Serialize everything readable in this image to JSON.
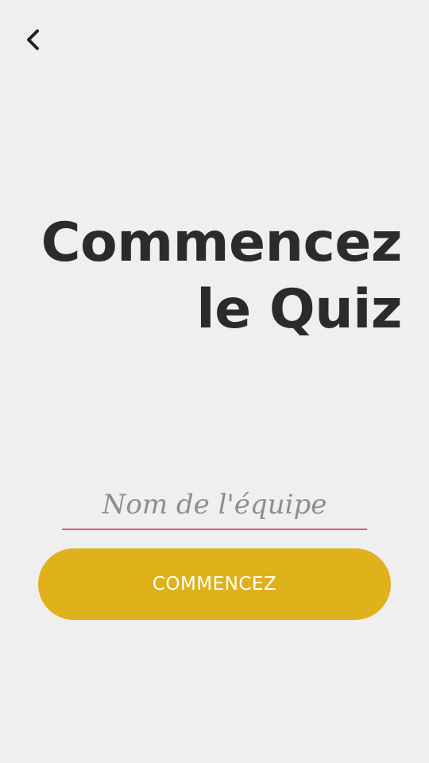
{
  "header": {
    "back_icon": "chevron-left-icon"
  },
  "hero": {
    "title_line1": "Commencez",
    "title_line2": "le Quiz"
  },
  "form": {
    "team_name_value": "",
    "team_name_placeholder": "Nom de l'équipe",
    "start_label": "COMMENCEZ"
  },
  "colors": {
    "background": "#efefef",
    "title_text": "#2b2b2b",
    "input_underline": "#e05a67",
    "placeholder": "#8e8e8e",
    "button_bg": "#dfb11b",
    "button_text": "#ffffff"
  }
}
